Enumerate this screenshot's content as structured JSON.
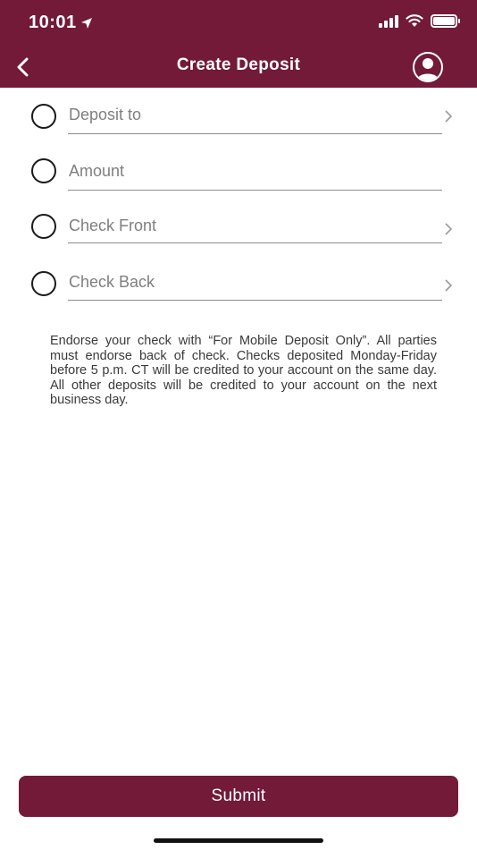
{
  "status_bar": {
    "time": "10:01"
  },
  "nav": {
    "title": "Create Deposit"
  },
  "fields": [
    {
      "label": "Deposit to",
      "has_chevron": true
    },
    {
      "label": "Amount",
      "has_chevron": false
    },
    {
      "label": "Check Front",
      "has_chevron": true
    },
    {
      "label": "Check Back",
      "has_chevron": true
    }
  ],
  "note": "Endorse your check with “For Mobile Deposit Only”. All parties must endorse back of check. Checks deposited Monday-Friday before 5 p.m. CT will be credited to your account on the same day. All other deposits will be credited to your account on the next business day.",
  "submit_label": "Submit",
  "colors": {
    "brand": "#721a37",
    "label": "#7f7f7f",
    "text": "#3a3a3a"
  },
  "icons": [
    "location-arrow-icon",
    "signal-icon",
    "wifi-icon",
    "battery-icon",
    "chevron-left-icon",
    "user-profile-icon",
    "chevron-right-icon"
  ]
}
